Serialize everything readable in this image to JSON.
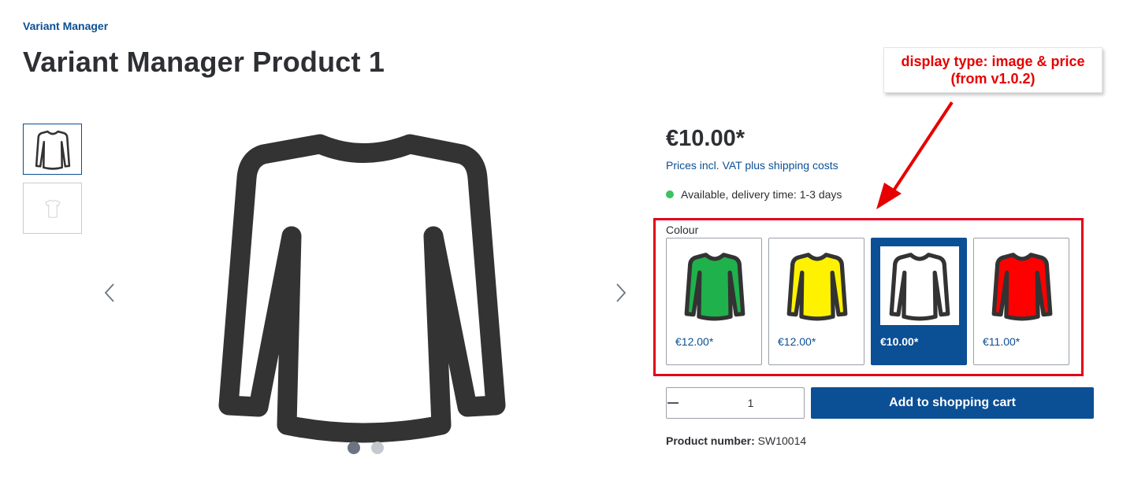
{
  "breadcrumb": "Variant Manager",
  "title": "Variant Manager Product 1",
  "gallery": {
    "thumbnails": [
      {
        "icon": "shirt-thumbnail-icon",
        "active": true
      },
      {
        "icon": "shirt-thumbnail-icon",
        "active": false
      }
    ],
    "main_image_icon": "long-sleeve-shirt-icon",
    "prev_icon": "chevron-left-icon",
    "next_icon": "chevron-right-icon",
    "dots": 2,
    "active_dot": 1
  },
  "product": {
    "price": "€10.00*",
    "tax_note": "Prices incl. VAT plus shipping costs",
    "availability": "Available, delivery time: 1-3 days",
    "availability_color": "#3cc261"
  },
  "variants": {
    "label": "Colour",
    "options": [
      {
        "color": "#1fb14b",
        "price": "€12.00*",
        "selected": false
      },
      {
        "color": "#fff200",
        "price": "€12.00*",
        "selected": false
      },
      {
        "color": "#ffffff",
        "price": "€10.00*",
        "selected": true
      },
      {
        "color": "#ff0000",
        "price": "€11.00*",
        "selected": false
      }
    ]
  },
  "quantity": {
    "value": "1",
    "minus_icon": "minus-icon",
    "plus_icon": "plus-icon"
  },
  "add_to_cart": "Add to shopping cart",
  "product_number": {
    "label": "Product number:",
    "value": "SW10014"
  },
  "annotation": {
    "line1": "display type: image & price",
    "line2": "(from v1.0.2)",
    "color": "#e60000"
  },
  "colors": {
    "primary": "#0b4f94",
    "text": "#2d2f33",
    "highlight": "#e2001a"
  }
}
